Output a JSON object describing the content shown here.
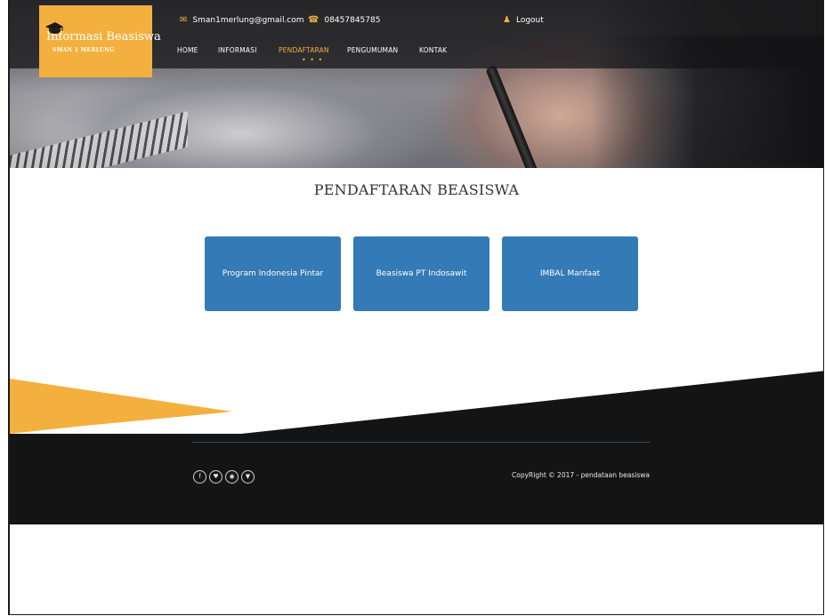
{
  "brand": {
    "title": "Informasi Beasiswa",
    "subtitle": "SMAN 1 MERLUNG"
  },
  "contact": {
    "email": "Sman1merlung@gmail.com",
    "phone": "08457845785",
    "logout_label": "Logout",
    "email_icon": "envelope-icon",
    "phone_icon": "phone-icon",
    "logout_icon": "user-icon"
  },
  "nav": {
    "items": [
      {
        "label": "HOME"
      },
      {
        "label": "INFORMASI"
      },
      {
        "label": "PENDAFTARAN",
        "active": true
      },
      {
        "label": "PENGUMUMAN"
      },
      {
        "label": "KONTAK"
      }
    ]
  },
  "main": {
    "title": "PENDAFTARAN BEASISWA",
    "programs": [
      {
        "label": "Program Indonesia Pintar"
      },
      {
        "label": "Beasiswa PT Indosawit"
      },
      {
        "label": "IMBAL Manfaat"
      }
    ]
  },
  "footer": {
    "social_icons": [
      "facebook-icon",
      "twitter-icon",
      "dribbble-icon",
      "pinterest-icon"
    ],
    "copyright": "CopyRight © 2017 - pendataan beasiswa"
  },
  "colors": {
    "accent": "#f4b03e",
    "button": "#337ab7",
    "footer": "#141414"
  }
}
